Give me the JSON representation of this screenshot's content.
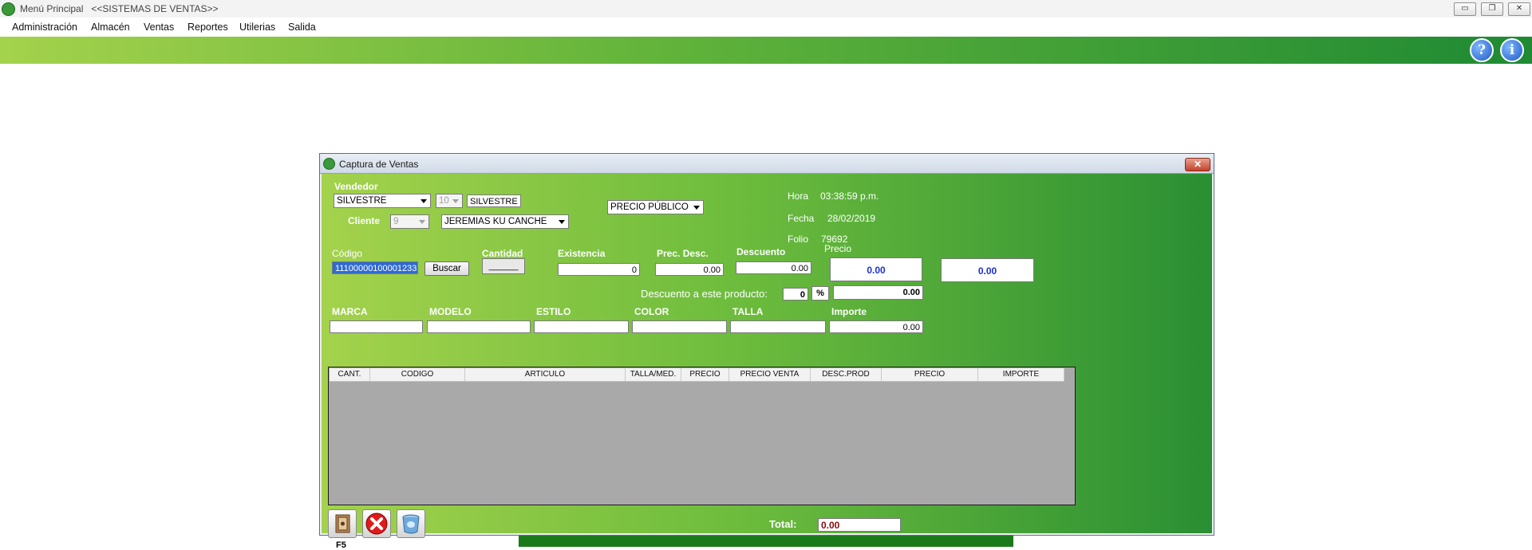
{
  "app": {
    "title": "Menú Principal   <<SISTEMAS DE VENTAS>>",
    "window_controls": {
      "minimize": "▭",
      "restore": "❐",
      "close": "✕"
    }
  },
  "menu": [
    {
      "label": "Administración"
    },
    {
      "label": "Almacén"
    },
    {
      "label": "Ventas"
    },
    {
      "label": "Reportes"
    },
    {
      "label": "Utilerias"
    },
    {
      "label": "Salida"
    }
  ],
  "ribbon": {
    "help_icon": "?",
    "info_icon": "i"
  },
  "dialog": {
    "title": "Captura de Ventas",
    "close_icon": "✕",
    "vendedor": {
      "label": "Vendedor",
      "name": "SILVESTRE",
      "id": "10",
      "display": "SILVESTRE"
    },
    "cliente": {
      "label": "Cliente",
      "id": "9",
      "name": "JEREMIAS KU CANCHE"
    },
    "price_type": "PRECIO PÚBLICO",
    "hora": {
      "label": "Hora",
      "value": "03:38:59 p.m."
    },
    "fecha": {
      "label": "Fecha",
      "value": "28/02/2019"
    },
    "folio": {
      "label": "Folio",
      "value": "79692"
    },
    "codigo": {
      "label": "Código",
      "value": "11100000100001233",
      "search_button": "Buscar"
    },
    "cantidad": {
      "label": "Cantidad",
      "value": "______"
    },
    "existencia": {
      "label": "Existencia",
      "value": "0"
    },
    "prec_desc": {
      "label": "Prec. Desc.",
      "value": "0.00"
    },
    "descuento": {
      "label": "Descuento",
      "value": "0.00"
    },
    "precio": {
      "label": "Precio",
      "value": "0.00"
    },
    "precio_extra": {
      "value": "0.00"
    },
    "descuento_producto": {
      "label": "Descuento a este producto:",
      "value": "0",
      "percent_label": "%",
      "amount": "0.00"
    },
    "attributes": {
      "marca": {
        "label": "MARCA",
        "value": ""
      },
      "modelo": {
        "label": "MODELO",
        "value": ""
      },
      "estilo": {
        "label": "ESTILO",
        "value": ""
      },
      "color": {
        "label": "COLOR",
        "value": ""
      },
      "talla": {
        "label": "TALLA",
        "value": ""
      },
      "importe": {
        "label": "Importe",
        "value": "0.00"
      }
    },
    "grid": {
      "columns": [
        "CANT.",
        "CODIGO",
        "ARTICULO",
        "TALLA/MED.",
        "PRECIO",
        "PRECIO VENTA",
        "DESC.PROD",
        "PRECIO",
        "IMPORTE"
      ],
      "rows": []
    },
    "toolbar": {
      "save_key": "F5",
      "save_icon": "safe-icon",
      "cancel_icon": "cancel-icon",
      "clear_icon": "trash-can-icon"
    },
    "total": {
      "label": "Total:",
      "value": "0.00"
    }
  },
  "colors": {
    "ribbon_start": "#a4d24c",
    "ribbon_end": "#1f8a33",
    "price_text": "#1d2fd6",
    "total_text": "#8b0a0a",
    "bottom_bar": "#1a7a1a"
  }
}
